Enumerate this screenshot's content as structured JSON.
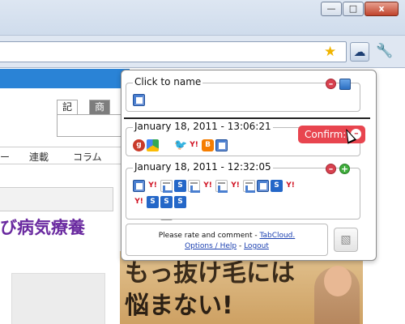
{
  "window": {
    "min_label": "—",
    "max_label": "□",
    "close_label": "x"
  },
  "toolbar": {
    "bookmark_icon": "star-icon",
    "extension_icon": "cloud-icon",
    "menu_icon": "wrench-icon"
  },
  "page": {
    "tabs": [
      "記事",
      "商品"
    ],
    "nav": [
      "ー",
      "連載",
      "コラム"
    ],
    "headline": "び病気療養",
    "ad_line1": "もっ抜け毛には",
    "ad_line2": "悩まない!"
  },
  "popup": {
    "new_group": {
      "title": "Click to name"
    },
    "groups": [
      {
        "title": "January 18, 2011 - 13:06:21",
        "confirm_label": "Confirm:"
      },
      {
        "title": "January 18, 2011 - 12:32:05"
      }
    ],
    "footer": {
      "line1": "Please rate and comment - ",
      "brand": "TabCloud.",
      "options": "Options / Help",
      "dash": " - ",
      "logout": "Logout"
    }
  }
}
